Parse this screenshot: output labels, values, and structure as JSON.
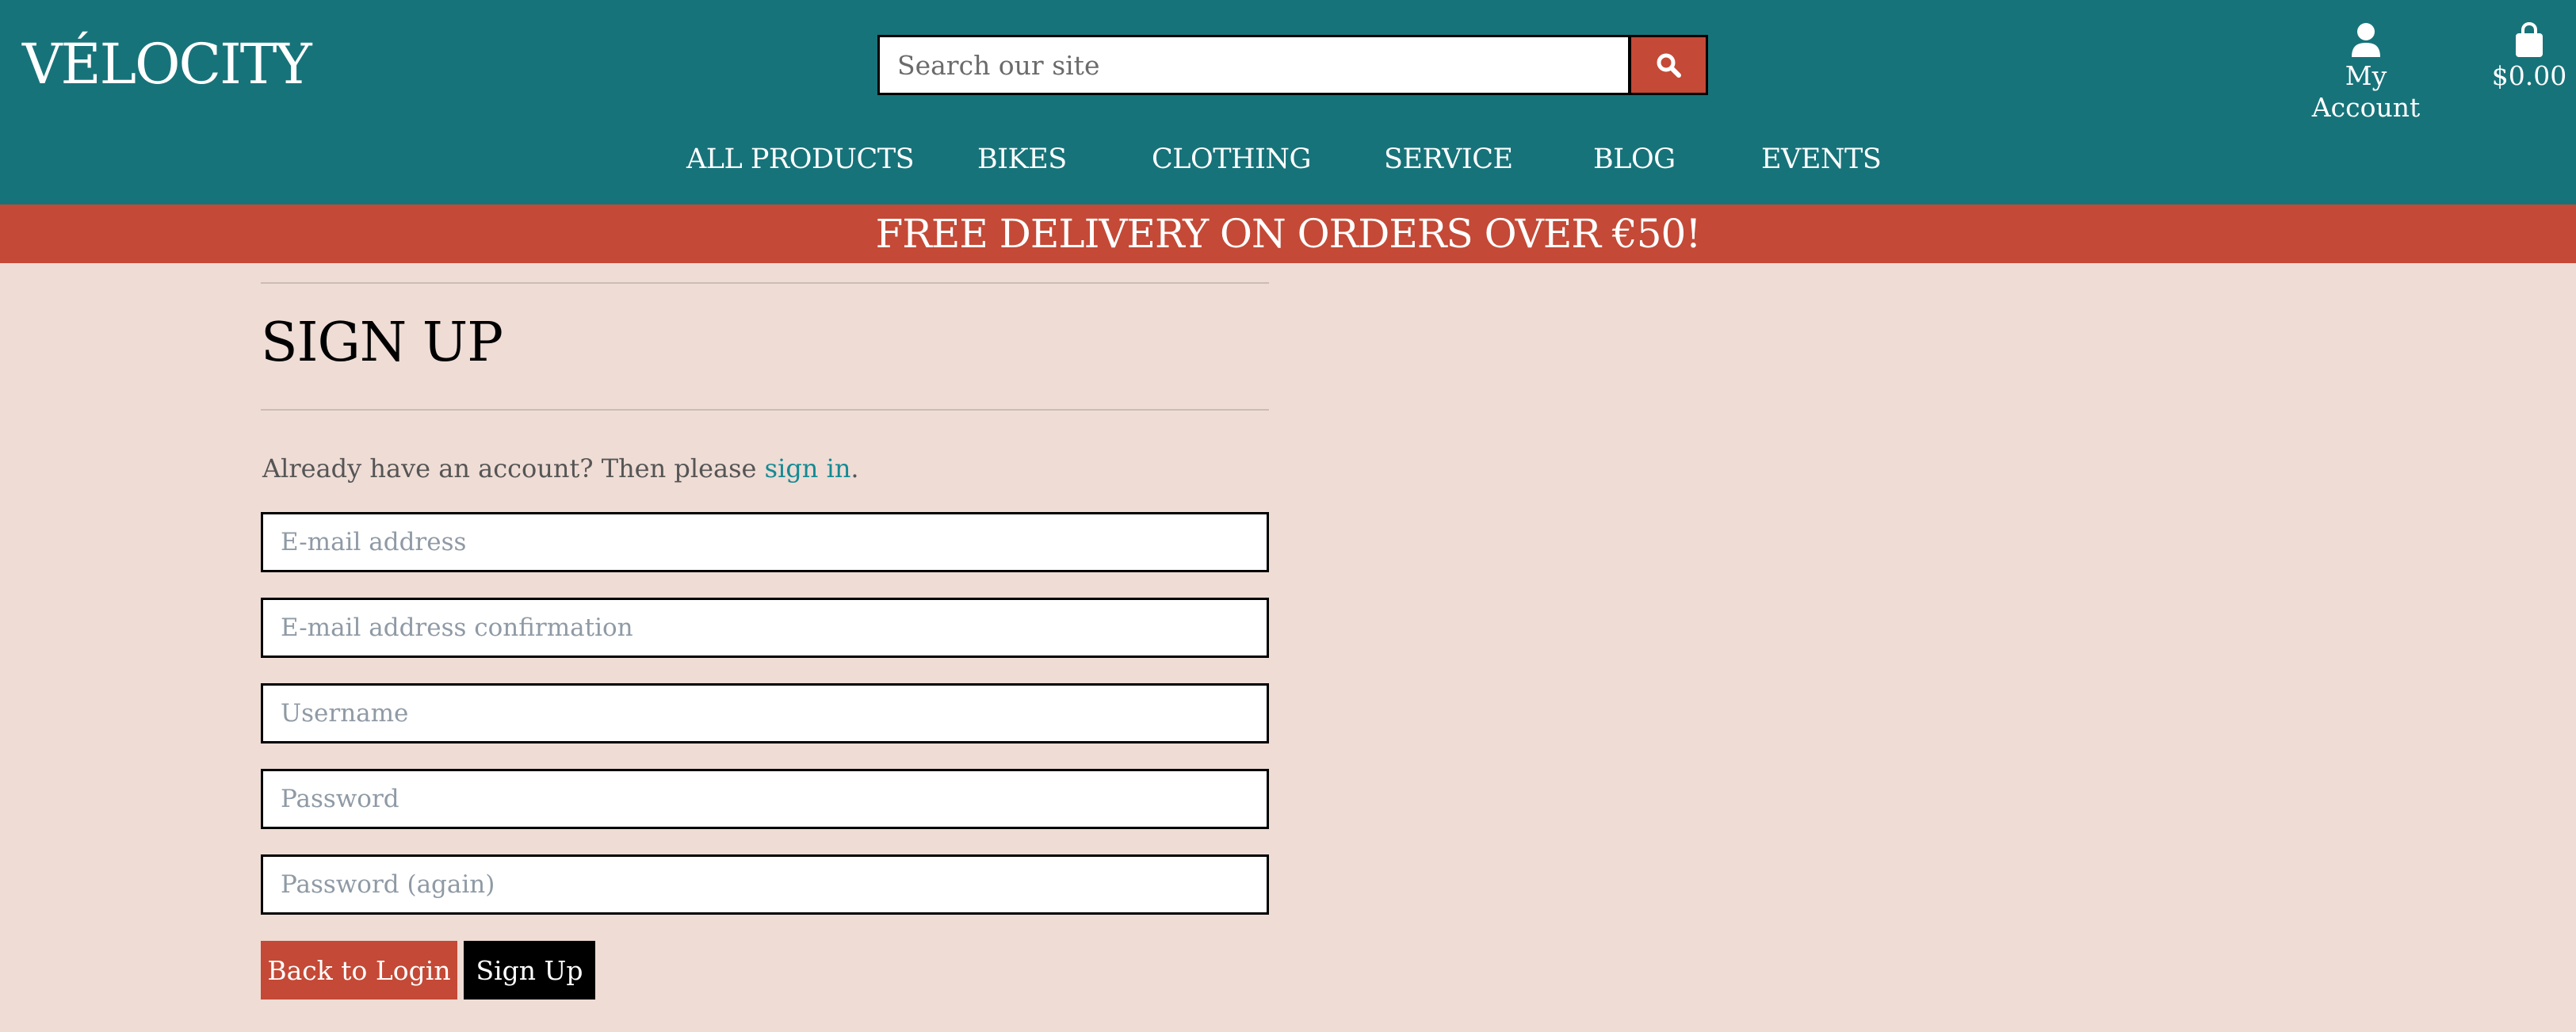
{
  "header": {
    "logo": "VÉLOCITY",
    "search": {
      "placeholder": "Search our site"
    },
    "account_label": "My Account",
    "bag_total": "$0.00"
  },
  "nav": {
    "items": [
      "ALL PRODUCTS",
      "BIKES",
      "CLOTHING",
      "SERVICE",
      "BLOG",
      "EVENTS"
    ]
  },
  "banner": "FREE DELIVERY ON ORDERS OVER €50!",
  "signup": {
    "title": "SIGN UP",
    "intro_prefix": "Already have an account? Then please ",
    "intro_link": "sign in",
    "intro_suffix": ".",
    "fields": [
      {
        "placeholder": "E-mail address"
      },
      {
        "placeholder": "E-mail address confirmation"
      },
      {
        "placeholder": "Username"
      },
      {
        "placeholder": "Password"
      },
      {
        "placeholder": "Password (again)"
      }
    ],
    "back_button": "Back to Login",
    "submit_button": "Sign Up"
  },
  "colors": {
    "header_bg": "#17737a",
    "accent_red": "#c44936",
    "page_bg": "#eedcd5",
    "link": "#138a93"
  },
  "icons": {
    "search": "search-icon",
    "account": "user-icon",
    "bag": "shopping-bag-icon"
  }
}
